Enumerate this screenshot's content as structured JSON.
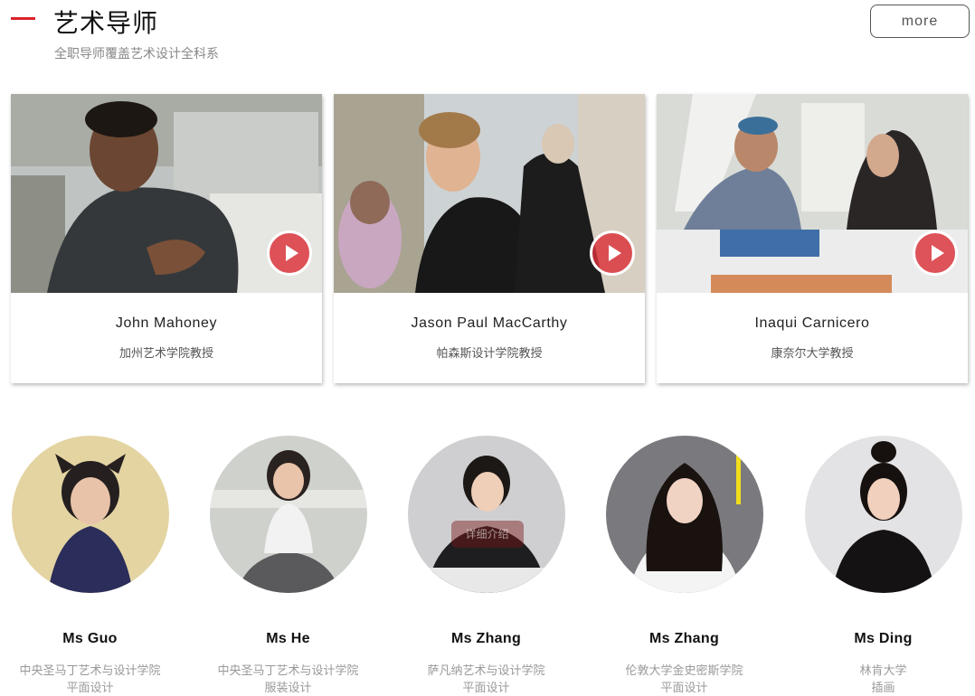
{
  "header": {
    "title": "艺术导师",
    "subtitle": "全职导师覆盖艺术设计全科系",
    "more_label": "more",
    "accent_color": "#d8232a"
  },
  "mentor_cards": [
    {
      "name": "John Mahoney",
      "school": "加州艺术学院教授",
      "icon": "play-icon"
    },
    {
      "name": "Jason Paul MacCarthy",
      "school": "帕森斯设计学院教授",
      "icon": "play-icon"
    },
    {
      "name": "Inaqui Carnicero",
      "school": "康奈尔大学教授",
      "icon": "play-icon"
    }
  ],
  "teachers": [
    {
      "name": "Ms Guo",
      "school": "中央圣马丁艺术与设计学院",
      "major": "平面设计"
    },
    {
      "name": "Ms He",
      "school": "中央圣马丁艺术与设计学院",
      "major": "服装设计"
    },
    {
      "name": "Ms Zhang",
      "school": "萨凡纳艺术与设计学院",
      "major": "平面设计",
      "overlay_label": "详细介绍"
    },
    {
      "name": "Ms Zhang",
      "school": "伦敦大学金史密斯学院",
      "major": "平面设计"
    },
    {
      "name": "Ms Ding",
      "school": "林肯大学",
      "major": "插画"
    }
  ]
}
